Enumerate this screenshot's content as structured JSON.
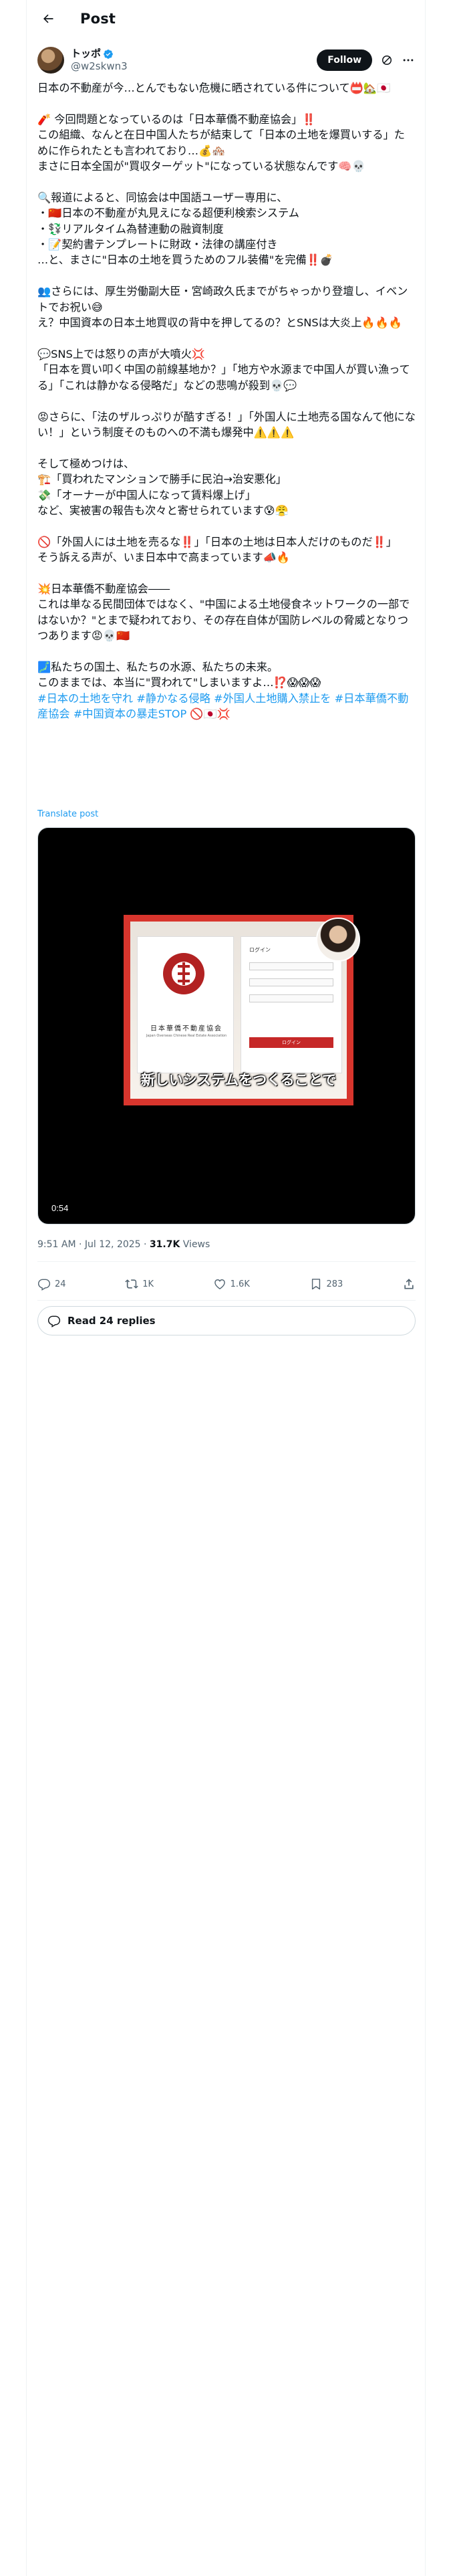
{
  "header": {
    "title": "Post"
  },
  "author": {
    "display_name": "トッポ",
    "handle": "@w2skwn3",
    "follow_label": "Follow"
  },
  "post": {
    "text": "日本の不動産が今…とんでもない危機に晒されている件について📛🏡🇯🇵\n\n🧨 今回問題となっているのは「日本華僑不動産協会」‼️\nこの組織、なんと在日中国人たちが結束して「日本の土地を爆買いする」ために作られたとも言われており…💰🏘️\nまさに日本全国が\"買収ターゲット\"になっている状態なんです🧠💀\n\n🔍報道によると、同協会は中国語ユーザー専用に、\n・🇨🇳日本の不動産が丸見えになる超便利検索システム\n・💱リアルタイム為替連動の融資制度\n・📝契約書テンプレートに財政・法律の講座付き\n…と、まさに\"日本の土地を買うためのフル装備\"を完備‼️💣\n\n👥さらには、厚生労働副大臣・宮崎政久氏までがちゃっかり登壇し、イベントでお祝い😅\nえ？中国資本の日本土地買収の背中を押してるの？とSNSは大炎上🔥🔥🔥\n\n💬SNS上では怒りの声が大噴火💢\n「日本を買い叩く中国の前線基地か？」「地方や水源まで中国人が買い漁ってる」「これは静かなる侵略だ」などの悲鳴が殺到💀💬\n\n😡さらに、「法のザルっぷりが酷すぎる！」「外国人に土地売る国なんて他にない！」という制度そのものへの不満も爆発中⚠️⚠️⚠️\n\nそして極めつけは、\n🏗️「買われたマンションで勝手に民泊→治安悪化」\n💸「オーナーが中国人になって賃料爆上げ」\nなど、実被害の報告も次々と寄せられています😰😤\n\n🚫「外国人には土地を売るな‼️」「日本の土地は日本人だけのものだ‼️」\nそう訴える声が、いま日本中で高まっています📣🔥\n\n💥日本華僑不動産協会――\nこれは単なる民間団体ではなく、\"中国による土地侵食ネットワークの一部ではないか？\"とまで疑われており、その存在自体が国防レベルの脅威となりつつあります😡💀🇨🇳\n\n🗾私たちの国土、私たちの水源、私たちの未来。\nこのままでは、本当に\"買われて\"しまいますよ…⁉️😱😱😱",
    "hashtags": "#日本の土地を守れ #静かなる侵略 #外国人土地購入禁止を #日本華僑不動産協会 #中国資本の暴走STOP 🚫🇯🇵💢",
    "translate_label": "Translate post"
  },
  "video": {
    "subtitle": "新しいシステムをつくることで",
    "duration": "0:54",
    "frame_title": "日本華僑不動産協会",
    "frame_subtitle": "Japan Overseas Chinese Real Estate Association",
    "login_title": "ログイン",
    "login_button": "ログイン"
  },
  "meta": {
    "time": "9:51 AM · Jul 12, 2025 · ",
    "views_count": "31.7K",
    "views_label": " Views"
  },
  "actions": {
    "replies": "24",
    "reposts": "1K",
    "likes": "1.6K",
    "bookmarks": "283"
  },
  "read_replies_label": "Read 24 replies",
  "colors": {
    "link": "#1d9bf0",
    "text": "#0f1419",
    "muted": "#536471",
    "accent_red": "#c62828"
  }
}
